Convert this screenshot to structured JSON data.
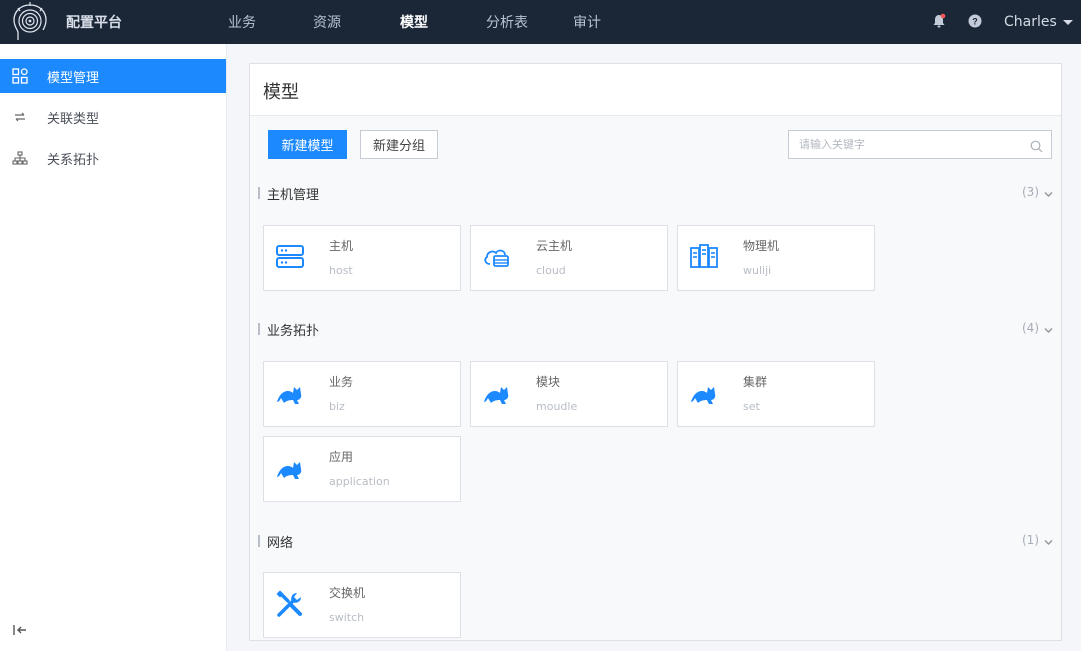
{
  "app": {
    "title": "配置平台"
  },
  "nav": {
    "items": [
      {
        "label": "业务"
      },
      {
        "label": "资源"
      },
      {
        "label": "模型",
        "active": true
      },
      {
        "label": "分析表"
      },
      {
        "label": "审计"
      }
    ]
  },
  "topbar": {
    "icons": [
      "notification-bell-icon",
      "help-icon"
    ],
    "user": "Charles"
  },
  "sidebar": {
    "items": [
      {
        "label": "模型管理",
        "icon": "grid-icon",
        "active": true
      },
      {
        "label": "关联类型",
        "icon": "link-icon"
      },
      {
        "label": "关系拓扑",
        "icon": "topology-icon"
      }
    ],
    "collapse_icon": "collapse-left-icon"
  },
  "main": {
    "title": "模型",
    "new_model_label": "新建模型",
    "new_group_label": "新建分组",
    "search_placeholder": "请输入关键字",
    "accent_color": "#1d89ff"
  },
  "groups": [
    {
      "name": "主机管理",
      "count": "(3)",
      "models": [
        {
          "name": "主机",
          "id": "host",
          "icon": "server-icon"
        },
        {
          "name": "云主机",
          "id": "cloud",
          "icon": "cloud-host-icon"
        },
        {
          "name": "物理机",
          "id": "wuliji",
          "icon": "physical-server-icon"
        }
      ]
    },
    {
      "name": "业务拓扑",
      "count": "(4)",
      "models": [
        {
          "name": "业务",
          "id": "biz",
          "icon": "cat-icon"
        },
        {
          "name": "模块",
          "id": "moudle",
          "icon": "cat-icon"
        },
        {
          "name": "集群",
          "id": "set",
          "icon": "cat-icon"
        },
        {
          "name": "应用",
          "id": "application",
          "icon": "cat-icon"
        }
      ]
    },
    {
      "name": "网络",
      "count": "(1)",
      "models": [
        {
          "name": "交换机",
          "id": "switch",
          "icon": "tools-icon"
        }
      ]
    }
  ]
}
